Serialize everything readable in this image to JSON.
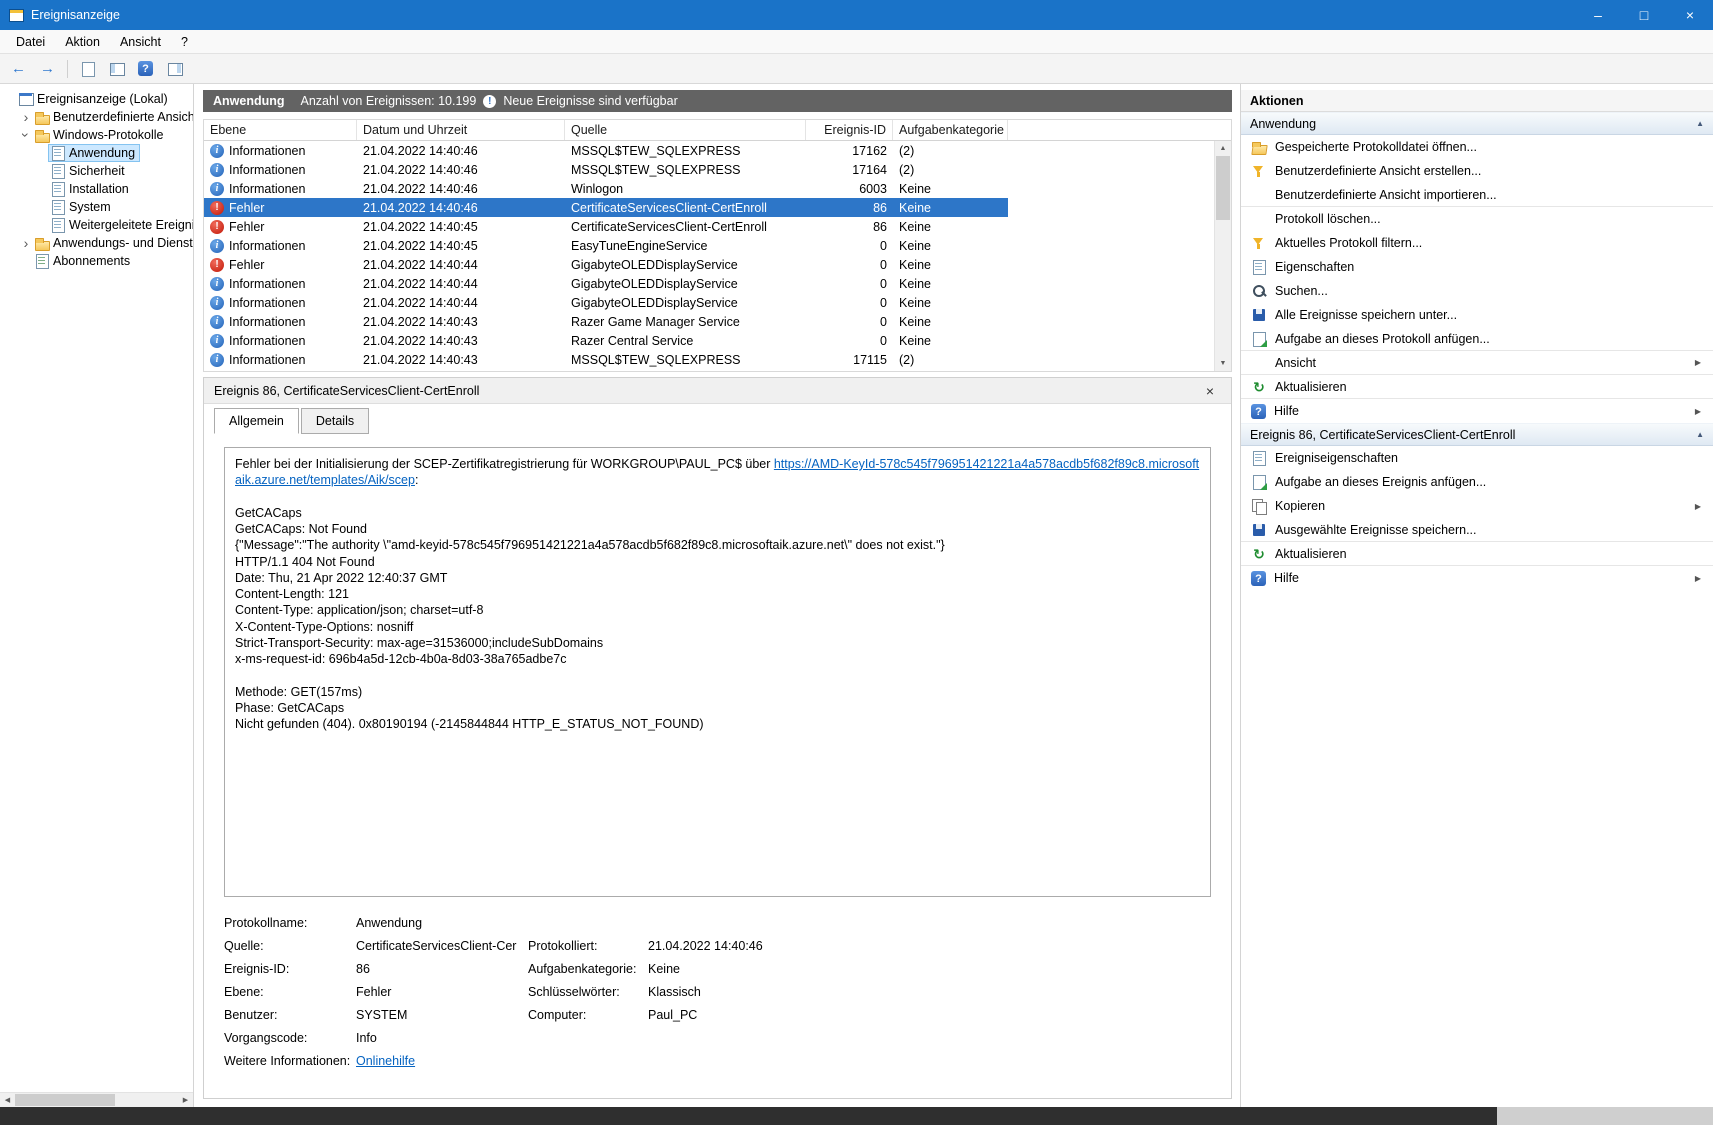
{
  "window": {
    "title": "Ereignisanzeige",
    "menu": [
      "Datei",
      "Aktion",
      "Ansicht",
      "?"
    ]
  },
  "toolbar": {
    "buttons": [
      "back-icon",
      "forward-icon",
      "document-icon",
      "console-tree-icon",
      "help-icon",
      "action-pane-icon"
    ]
  },
  "tree": {
    "items": [
      {
        "label": "Ereignisanzeige (Lokal)",
        "level": 0,
        "icon": "console-root-icon",
        "expand": "none"
      },
      {
        "label": "Benutzerdefinierte Ansichten",
        "level": 1,
        "icon": "folder-icon",
        "expand": "collapsed"
      },
      {
        "label": "Windows-Protokolle",
        "level": 1,
        "icon": "folder-icon",
        "expand": "expanded"
      },
      {
        "label": "Anwendung",
        "level": 2,
        "icon": "log-icon",
        "expand": "none",
        "selected": true
      },
      {
        "label": "Sicherheit",
        "level": 2,
        "icon": "log-icon",
        "expand": "none"
      },
      {
        "label": "Installation",
        "level": 2,
        "icon": "log-icon",
        "expand": "none"
      },
      {
        "label": "System",
        "level": 2,
        "icon": "log-icon",
        "expand": "none"
      },
      {
        "label": "Weitergeleitete Ereignisse",
        "level": 2,
        "icon": "log-icon",
        "expand": "none"
      },
      {
        "label": "Anwendungs- und Dienstprotokolle",
        "level": 1,
        "icon": "folder-icon",
        "expand": "collapsed"
      },
      {
        "label": "Abonnements",
        "level": 1,
        "icon": "subscriptions-icon",
        "expand": "none"
      }
    ]
  },
  "main": {
    "header": {
      "title": "Anwendung",
      "count": "Anzahl von Ereignissen: 10.199",
      "new_events": "Neue Ereignisse sind verfügbar"
    },
    "table": {
      "columns": [
        "Ebene",
        "Datum und Uhrzeit",
        "Quelle",
        "Ereignis-ID",
        "Aufgabenkategorie"
      ],
      "rows": [
        {
          "type": "info",
          "level": "Informationen",
          "datetime": "21.04.2022 14:40:46",
          "source": "MSSQL$TEW_SQLEXPRESS",
          "event_id": "17162",
          "category": "(2)"
        },
        {
          "type": "info",
          "level": "Informationen",
          "datetime": "21.04.2022 14:40:46",
          "source": "MSSQL$TEW_SQLEXPRESS",
          "event_id": "17164",
          "category": "(2)"
        },
        {
          "type": "info",
          "level": "Informationen",
          "datetime": "21.04.2022 14:40:46",
          "source": "Winlogon",
          "event_id": "6003",
          "category": "Keine"
        },
        {
          "type": "error",
          "level": "Fehler",
          "datetime": "21.04.2022 14:40:46",
          "source": "CertificateServicesClient-CertEnroll",
          "event_id": "86",
          "category": "Keine",
          "selected": true
        },
        {
          "type": "error",
          "level": "Fehler",
          "datetime": "21.04.2022 14:40:45",
          "source": "CertificateServicesClient-CertEnroll",
          "event_id": "86",
          "category": "Keine"
        },
        {
          "type": "info",
          "level": "Informationen",
          "datetime": "21.04.2022 14:40:45",
          "source": "EasyTuneEngineService",
          "event_id": "0",
          "category": "Keine"
        },
        {
          "type": "error",
          "level": "Fehler",
          "datetime": "21.04.2022 14:40:44",
          "source": "GigabyteOLEDDisplayService",
          "event_id": "0",
          "category": "Keine"
        },
        {
          "type": "info",
          "level": "Informationen",
          "datetime": "21.04.2022 14:40:44",
          "source": "GigabyteOLEDDisplayService",
          "event_id": "0",
          "category": "Keine"
        },
        {
          "type": "info",
          "level": "Informationen",
          "datetime": "21.04.2022 14:40:44",
          "source": "GigabyteOLEDDisplayService",
          "event_id": "0",
          "category": "Keine"
        },
        {
          "type": "info",
          "level": "Informationen",
          "datetime": "21.04.2022 14:40:43",
          "source": "Razer Game Manager Service",
          "event_id": "0",
          "category": "Keine"
        },
        {
          "type": "info",
          "level": "Informationen",
          "datetime": "21.04.2022 14:40:43",
          "source": "Razer Central Service",
          "event_id": "0",
          "category": "Keine"
        },
        {
          "type": "info",
          "level": "Informationen",
          "datetime": "21.04.2022 14:40:43",
          "source": "MSSQL$TEW_SQLEXPRESS",
          "event_id": "17115",
          "category": "(2)"
        }
      ]
    }
  },
  "detail": {
    "title": "Ereignis 86, CertificateServicesClient-CertEnroll",
    "tabs": [
      {
        "label": "Allgemein",
        "active": true
      },
      {
        "label": "Details",
        "active": false
      }
    ],
    "message": {
      "intro": "Fehler bei der Initialisierung der SCEP-Zertifikatregistrierung für WORKGROUP\\PAUL_PC$ über ",
      "link": "https://AMD-KeyId-578c545f796951421221a4a578acdb5f682f89c8.microsoftaik.azure.net/templates/Aik/scep",
      "after_link": ":",
      "body": "\n\nGetCACaps\nGetCACaps: Not Found\n{\"Message\":\"The authority \\\"amd-keyid-578c545f796951421221a4a578acdb5f682f89c8.microsoftaik.azure.net\\\" does not exist.\"}\nHTTP/1.1 404 Not Found\nDate: Thu, 21 Apr 2022 12:40:37 GMT\nContent-Length: 121\nContent-Type: application/json; charset=utf-8\nX-Content-Type-Options: nosniff\nStrict-Transport-Security: max-age=31536000;includeSubDomains\nx-ms-request-id: 696b4a5d-12cb-4b0a-8d03-38a765adbe7c\n\nMethode: GET(157ms)\nPhase: GetCACaps\nNicht gefunden (404). 0x80190194 (-2145844844 HTTP_E_STATUS_NOT_FOUND)"
    },
    "fields": [
      {
        "l": "Protokollname:",
        "lv": "Anwendung",
        "r": "",
        "rv": ""
      },
      {
        "l": "Quelle:",
        "lv": "CertificateServicesClient-Cer",
        "r": "Protokolliert:",
        "rv": "21.04.2022 14:40:46"
      },
      {
        "l": "Ereignis-ID:",
        "lv": "86",
        "r": "Aufgabenkategorie:",
        "rv": "Keine"
      },
      {
        "l": "Ebene:",
        "lv": "Fehler",
        "r": "Schlüsselwörter:",
        "rv": "Klassisch"
      },
      {
        "l": "Benutzer:",
        "lv": "SYSTEM",
        "r": "Computer:",
        "rv": "Paul_PC"
      },
      {
        "l": "Vorgangscode:",
        "lv": "Info",
        "r": "",
        "rv": ""
      },
      {
        "l": "Weitere Informationen:",
        "lv": "Onlinehilfe",
        "r": "",
        "rv": "",
        "link": true
      }
    ]
  },
  "actions": {
    "title": "Aktionen",
    "sections": [
      {
        "header": "Anwendung",
        "items": [
          {
            "label": "Gespeicherte Protokolldatei öffnen...",
            "icon": "folder-open-icon"
          },
          {
            "label": "Benutzerdefinierte Ansicht erstellen...",
            "icon": "funnel-icon"
          },
          {
            "label": "Benutzerdefinierte Ansicht importieren...",
            "icon": "none-icon",
            "sep_after": true
          },
          {
            "label": "Protokoll löschen...",
            "icon": "none-icon"
          },
          {
            "label": "Aktuelles Protokoll filtern...",
            "icon": "funnel-icon"
          },
          {
            "label": "Eigenschaften",
            "icon": "props-icon"
          },
          {
            "label": "Suchen...",
            "icon": "search-icon"
          },
          {
            "label": "Alle Ereignisse speichern unter...",
            "icon": "save-icon"
          },
          {
            "label": "Aufgabe an dieses Protokoll anfügen...",
            "icon": "task-icon",
            "sep_after": true
          },
          {
            "label": "Ansicht",
            "icon": "none-icon",
            "submenu": true,
            "sep_after": true
          },
          {
            "label": "Aktualisieren",
            "icon": "refresh-icon",
            "sep_after": true
          },
          {
            "label": "Hilfe",
            "icon": "help-icon",
            "submenu": true
          }
        ]
      },
      {
        "header": "Ereignis 86, CertificateServicesClient-CertEnroll",
        "items": [
          {
            "label": "Ereigniseigenschaften",
            "icon": "props-icon"
          },
          {
            "label": "Aufgabe an dieses Ereignis anfügen...",
            "icon": "task-icon"
          },
          {
            "label": "Kopieren",
            "icon": "copy-icon",
            "submenu": true
          },
          {
            "label": "Ausgewählte Ereignisse speichern...",
            "icon": "save-icon",
            "sep_after": true
          },
          {
            "label": "Aktualisieren",
            "icon": "refresh-icon",
            "sep_after": true
          },
          {
            "label": "Hilfe",
            "icon": "help-icon",
            "submenu": true
          }
        ]
      }
    ]
  }
}
